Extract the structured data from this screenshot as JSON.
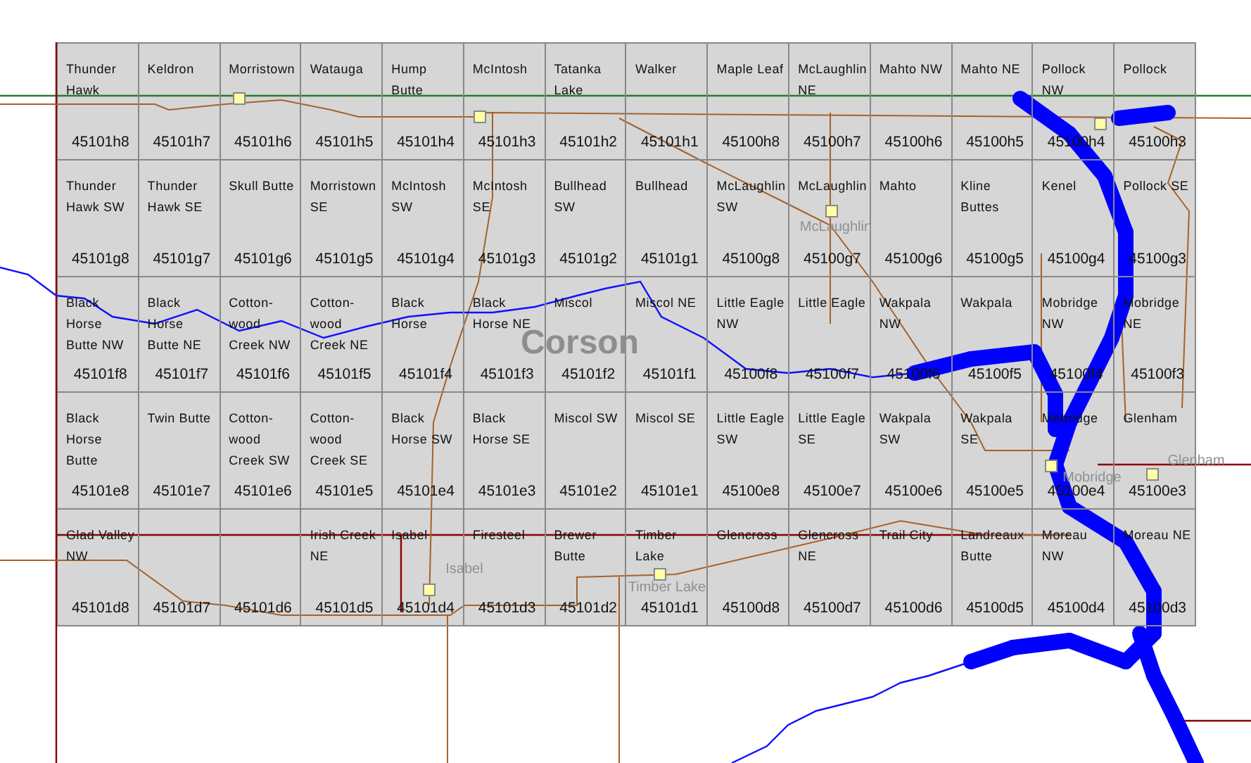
{
  "map": {
    "county_label": "Corson",
    "rows": [
      {
        "cells": [
          {
            "name": "Thunder Hawk",
            "code": "45101h8"
          },
          {
            "name": "Keldron",
            "code": "45101h7"
          },
          {
            "name": "Morristown",
            "code": "45101h6"
          },
          {
            "name": "Watauga",
            "code": "45101h5"
          },
          {
            "name": "Hump Butte",
            "code": "45101h4"
          },
          {
            "name": "McIntosh",
            "code": "45101h3"
          },
          {
            "name": "Tatanka Lake",
            "code": "45101h2"
          },
          {
            "name": "Walker",
            "code": "45101h1"
          },
          {
            "name": "Maple Leaf",
            "code": "45100h8"
          },
          {
            "name": "McLaughlin NE",
            "code": "45100h7"
          },
          {
            "name": "Mahto NW",
            "code": "45100h6"
          },
          {
            "name": "Mahto NE",
            "code": "45100h5"
          },
          {
            "name": "Pollock NW",
            "code": "45100h4"
          },
          {
            "name": "Pollock",
            "code": "45100h3"
          }
        ]
      },
      {
        "cells": [
          {
            "name": "Thunder Hawk SW",
            "code": "45101g8"
          },
          {
            "name": "Thunder Hawk SE",
            "code": "45101g7"
          },
          {
            "name": "Skull Butte",
            "code": "45101g6"
          },
          {
            "name": "Morristown SE",
            "code": "45101g5"
          },
          {
            "name": "McIntosh SW",
            "code": "45101g4"
          },
          {
            "name": "McIntosh SE",
            "code": "45101g3"
          },
          {
            "name": "Bullhead SW",
            "code": "45101g2"
          },
          {
            "name": "Bullhead",
            "code": "45101g1"
          },
          {
            "name": "McLaughlin SW",
            "code": "45100g8"
          },
          {
            "name": "McLaughlin",
            "code": "45100g7"
          },
          {
            "name": "Mahto",
            "code": "45100g6"
          },
          {
            "name": "Kline Buttes",
            "code": "45100g5"
          },
          {
            "name": "Kenel",
            "code": "45100g4"
          },
          {
            "name": "Pollock SE",
            "code": "45100g3"
          }
        ]
      },
      {
        "cells": [
          {
            "name": "Black Horse Butte NW",
            "code": "45101f8"
          },
          {
            "name": "Black Horse Butte NE",
            "code": "45101f7"
          },
          {
            "name": "Cotton-wood Creek NW",
            "code": "45101f6"
          },
          {
            "name": "Cotton-wood Creek NE",
            "code": "45101f5"
          },
          {
            "name": "Black Horse",
            "code": "45101f4"
          },
          {
            "name": "Black Horse NE",
            "code": "45101f3"
          },
          {
            "name": "Miscol",
            "code": "45101f2"
          },
          {
            "name": "Miscol NE",
            "code": "45101f1"
          },
          {
            "name": "Little Eagle NW",
            "code": "45100f8"
          },
          {
            "name": "Little Eagle",
            "code": "45100f7"
          },
          {
            "name": "Wakpala NW",
            "code": "45100f6"
          },
          {
            "name": "Wakpala",
            "code": "45100f5"
          },
          {
            "name": "Mobridge NW",
            "code": "45100f4"
          },
          {
            "name": "Mobridge NE",
            "code": "45100f3"
          }
        ]
      },
      {
        "cells": [
          {
            "name": "Black Horse Butte",
            "code": "45101e8"
          },
          {
            "name": "Twin Butte",
            "code": "45101e7"
          },
          {
            "name": "Cotton-wood Creek SW",
            "code": "45101e6"
          },
          {
            "name": "Cotton-wood Creek SE",
            "code": "45101e5"
          },
          {
            "name": "Black Horse SW",
            "code": "45101e4"
          },
          {
            "name": "Black Horse SE",
            "code": "45101e3"
          },
          {
            "name": "Miscol SW",
            "code": "45101e2"
          },
          {
            "name": "Miscol SE",
            "code": "45101e1"
          },
          {
            "name": "Little Eagle SW",
            "code": "45100e8"
          },
          {
            "name": "Little Eagle SE",
            "code": "45100e7"
          },
          {
            "name": "Wakpala SW",
            "code": "45100e6"
          },
          {
            "name": "Wakpala SE",
            "code": "45100e5"
          },
          {
            "name": "Mobridge",
            "code": "45100e4"
          },
          {
            "name": "Glenham",
            "code": "45100e3"
          }
        ]
      },
      {
        "cells": [
          {
            "name": "Glad Valley NW",
            "code": "45101d8"
          },
          {
            "code": "45101d7"
          },
          {
            "code": "45101d6"
          },
          {
            "name": "Irish Creek NE",
            "code": "45101d5"
          },
          {
            "name": "Isabel",
            "code": "45101d4"
          },
          {
            "name": "Firesteel",
            "code": "45101d3"
          },
          {
            "name": "Brewer Butte",
            "code": "45101d2"
          },
          {
            "name": "Timber Lake",
            "code": "45101d1"
          },
          {
            "name": "Glencross",
            "code": "45100d8"
          },
          {
            "name": "Glencross NE",
            "code": "45100d7"
          },
          {
            "name": "Trail City",
            "code": "45100d6"
          },
          {
            "name": "Landreaux Butte",
            "code": "45100d5"
          },
          {
            "name": "Moreau NW",
            "code": "45100d4"
          },
          {
            "name": "Moreau NE",
            "code": "45100d3"
          }
        ]
      }
    ],
    "towns": [
      {
        "name": "McLaughlin"
      },
      {
        "name": "Isabel"
      },
      {
        "name": "Timber Lake"
      },
      {
        "name": "Mobridge"
      },
      {
        "name": "Glenham"
      }
    ]
  }
}
